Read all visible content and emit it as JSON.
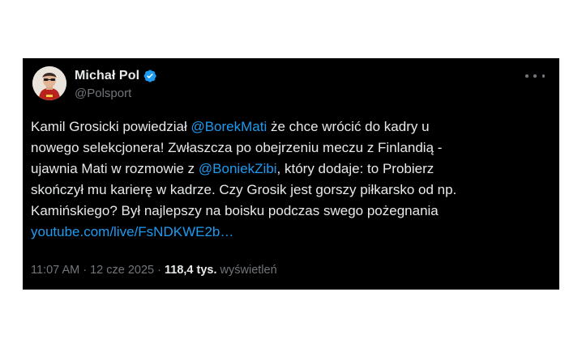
{
  "author": {
    "display_name": "Michał Pol",
    "handle": "@Polsport",
    "verified": true,
    "verified_color": "#1d9bf0"
  },
  "menu": {
    "icon": "more-horizontal-icon"
  },
  "tweet": {
    "lines": [
      {
        "segments": [
          {
            "type": "text",
            "value": "Kamil Grosicki powiedział "
          },
          {
            "type": "mention",
            "value": "@BorekMati"
          },
          {
            "type": "text",
            "value": " że chce wrócić do kadry u"
          }
        ]
      },
      {
        "segments": [
          {
            "type": "text",
            "value": "nowego selekcjonera! Zwłaszcza po obejrzeniu meczu z Finlandią -"
          }
        ]
      },
      {
        "segments": [
          {
            "type": "text",
            "value": "ujawnia Mati w rozmowie z "
          },
          {
            "type": "mention",
            "value": "@BoniekZibi"
          },
          {
            "type": "text",
            "value": ", który dodaje: to Probierz"
          }
        ]
      },
      {
        "segments": [
          {
            "type": "text",
            "value": "skończył mu karierę w kadrze. Czy Grosik jest gorszy piłkarsko od np."
          }
        ]
      },
      {
        "segments": [
          {
            "type": "text",
            "value": "Kamińskiego? Był najlepszy na boisku podczas swego pożegnania"
          }
        ]
      },
      {
        "segments": [
          {
            "type": "link",
            "value": "youtube.com/live/FsNDKWE2b…"
          }
        ]
      }
    ]
  },
  "meta": {
    "time": "11:07 AM",
    "separator": " · ",
    "date": "12 cze 2025",
    "views_count": "118,4 tys.",
    "views_label": " wyświetleń"
  },
  "colors": {
    "background": "#000000",
    "text": "#e7e9ea",
    "secondary": "#71767b",
    "accent": "#1d9bf0"
  }
}
